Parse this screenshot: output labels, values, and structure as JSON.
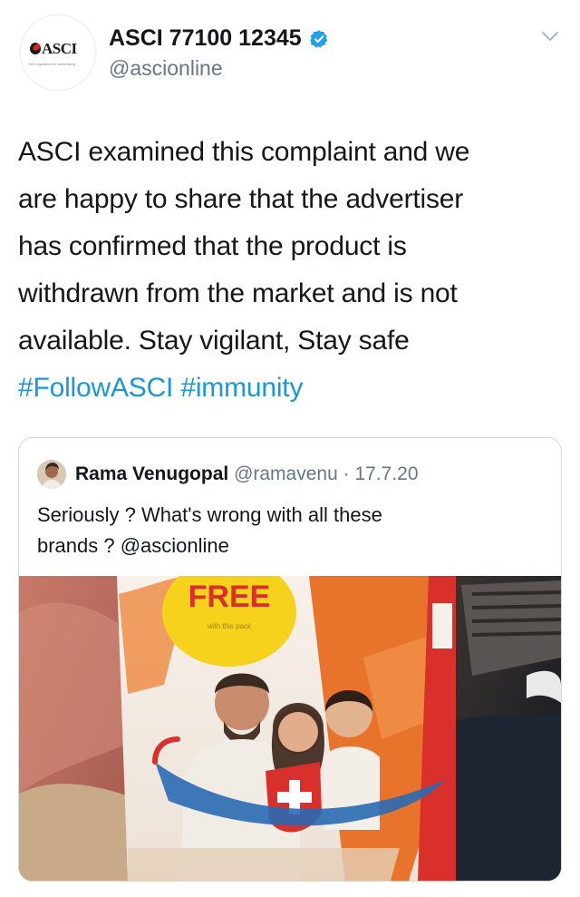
{
  "header": {
    "display_name": "ASCI 77100 12345",
    "handle": "@ascionline",
    "logo_text": "ASCI",
    "logo_tagline": "Self-regulation for advertising"
  },
  "tweet": {
    "lines": [
      "ASCI examined this complaint and we",
      "are happy to share that the advertiser",
      "has confirmed that the product is",
      "withdrawn from the market and is not",
      "available. Stay vigilant, Stay safe"
    ],
    "hashtags": [
      "#FollowASCI",
      "#immunity"
    ]
  },
  "quote": {
    "name": "Rama Venugopal",
    "handle": "@ramavenu",
    "separator": "·",
    "date": "17.7.20",
    "lines": [
      "Seriously ? What's wrong with all these",
      "brands ? @ascionline"
    ],
    "media": {
      "badge_text": "FREE",
      "badge_subtext": "with this pack"
    }
  },
  "colors": {
    "link": "#1b95e0",
    "verified": "#1da1f2",
    "secondary_text": "#657786",
    "badge_yellow": "#f6d21c",
    "pack_orange": "#e8732a"
  }
}
